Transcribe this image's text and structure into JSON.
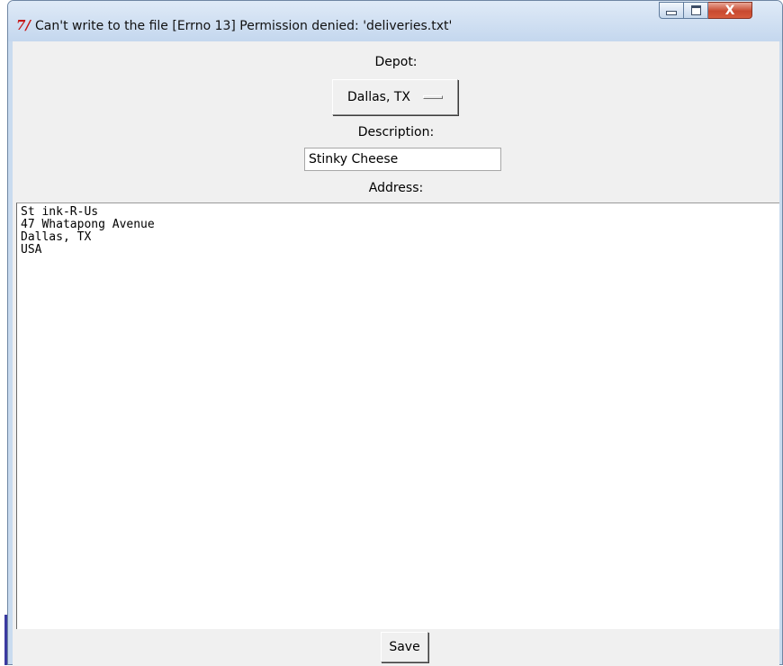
{
  "window": {
    "title": "Can't write to the file [Errno 13] Permission denied: 'deliveries.txt'",
    "icon_text": "7/",
    "close_glyph": "X",
    "accent_close": "#c8492f"
  },
  "form": {
    "depot_label": "Depot:",
    "depot_value": "Dallas, TX",
    "description_label": "Description:",
    "description_value": "Stinky Cheese",
    "address_label": "Address:",
    "address_value": "St ink-R-Us\n47 Whatapong Avenue\nDallas, TX\nUSA",
    "save_label": "Save"
  }
}
